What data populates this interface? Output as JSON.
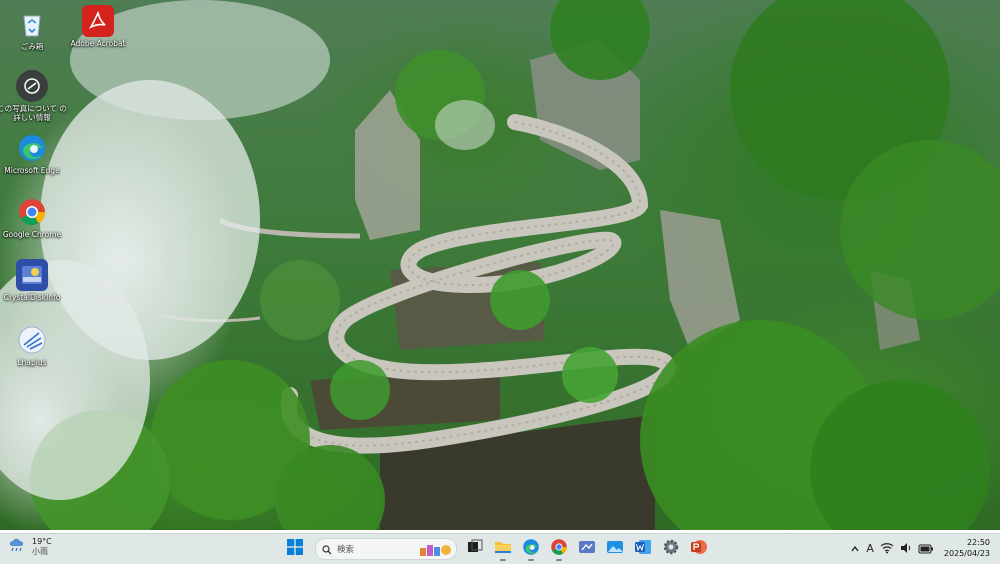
{
  "desktop": {
    "icons": [
      {
        "label": "ごみ箱",
        "icon": "recycle-bin-icon"
      },
      {
        "label": "Adobe Acrobat",
        "icon": "adobe-acrobat-icon"
      },
      {
        "label": "この写真について の詳しい情報",
        "icon": "camera-info-icon"
      },
      {
        "label": "Microsoft Edge",
        "icon": "edge-icon"
      },
      {
        "label": "Google Chrome",
        "icon": "chrome-icon"
      },
      {
        "label": "CrystalDiskInfo",
        "icon": "crystaldiskinfo-icon"
      },
      {
        "label": "Lhaplus",
        "icon": "lhaplus-icon"
      }
    ]
  },
  "taskbar": {
    "weather": {
      "temp": "19°C",
      "condition": "小雨",
      "icon": "rain-cloud-icon"
    },
    "start_icon": "windows-start-icon",
    "search": {
      "placeholder": "検索",
      "icon": "search-icon"
    },
    "pinned": [
      {
        "name": "task-view",
        "icon": "task-view-icon"
      },
      {
        "name": "file-explorer",
        "icon": "folder-icon"
      },
      {
        "name": "edge",
        "icon": "edge-icon"
      },
      {
        "name": "chrome",
        "icon": "chrome-icon"
      },
      {
        "name": "snipping-tool",
        "icon": "snipping-tool-icon"
      },
      {
        "name": "photos",
        "icon": "photos-icon"
      },
      {
        "name": "word",
        "icon": "word-icon"
      },
      {
        "name": "settings",
        "icon": "gear-icon"
      },
      {
        "name": "powerpoint",
        "icon": "powerpoint-icon"
      }
    ],
    "tray": {
      "ime": "A",
      "clock_time": "22:50",
      "clock_date": "2025/04/23"
    }
  },
  "colors": {
    "taskbar_bg": "#dfe8e6",
    "accent": "#0078d4"
  }
}
